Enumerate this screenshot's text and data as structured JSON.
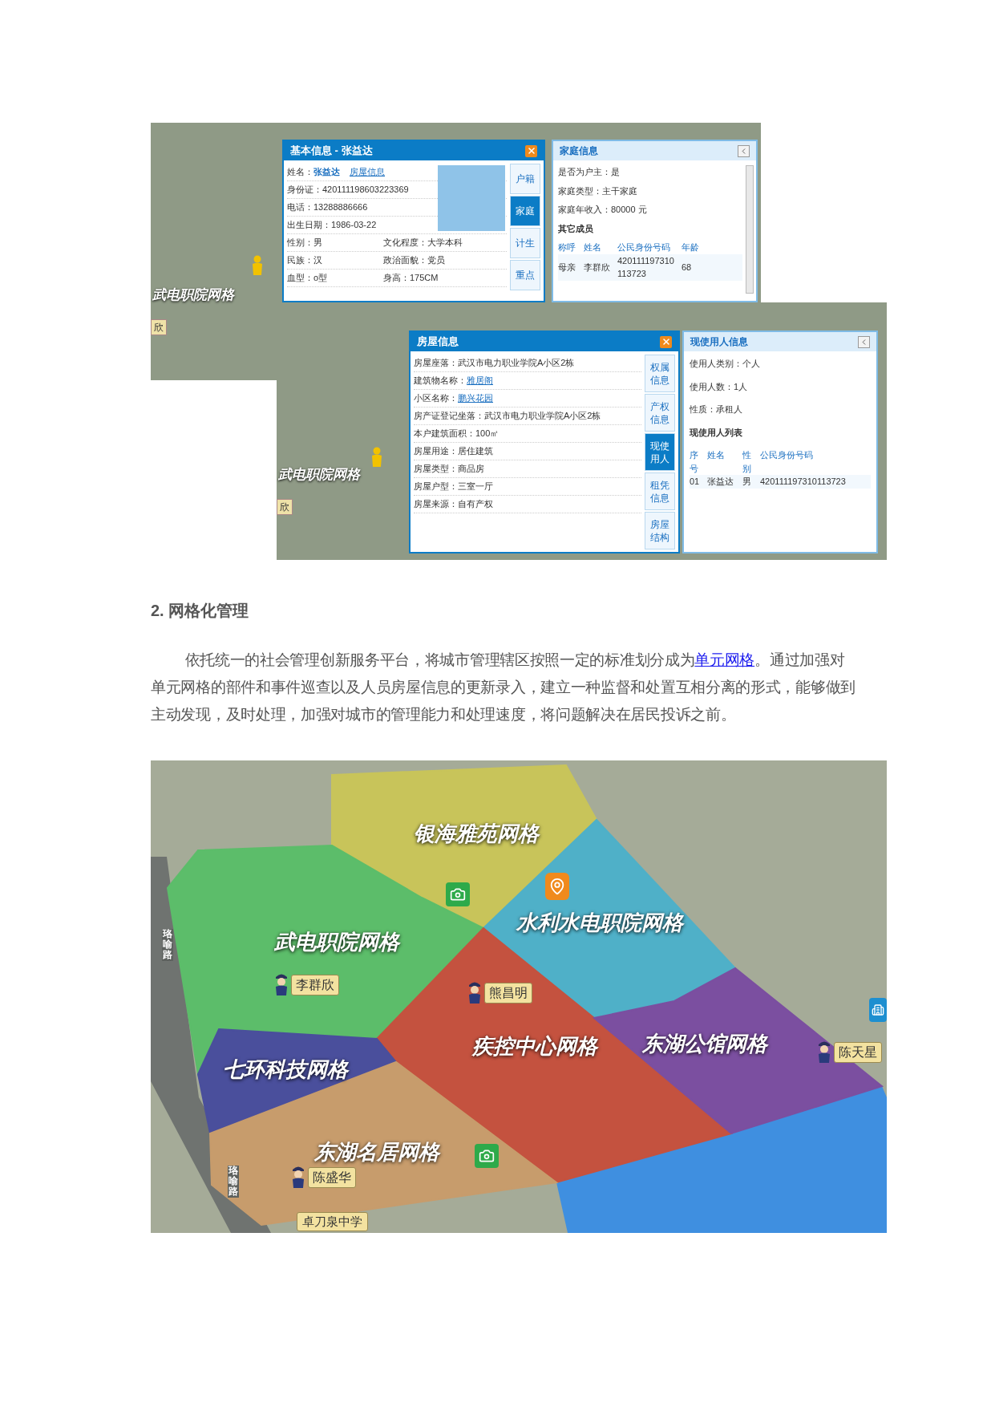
{
  "figure_1": {
    "screenshot_1": {
      "map_labels": [
        "武电职院网格"
      ],
      "map_badges": [
        "欣"
      ],
      "basic_info_panel": {
        "title": "基本信息 - 张益达",
        "rows": [
          [
            {
              "label": "姓名：",
              "value": "张益达",
              "kind": "highlight"
            },
            {
              "value": "房屋信息",
              "kind": "link"
            }
          ],
          [
            {
              "label": "身份证：",
              "value": "420111198603223369",
              "kind": "plain"
            }
          ],
          [
            {
              "label": "电话：",
              "value": "13288886666",
              "kind": "plain"
            }
          ],
          [
            {
              "label": "出生日期：",
              "value": "1986-03-22",
              "kind": "plain"
            }
          ],
          [
            {
              "label": "性别：",
              "value": "男",
              "kind": "plain"
            },
            {
              "label": "文化程度：",
              "value": "大学本科",
              "kind": "plain"
            }
          ],
          [
            {
              "label": "民族：",
              "value": "汉",
              "kind": "plain"
            },
            {
              "label": "政治面貌：",
              "value": "党员",
              "kind": "plain"
            }
          ],
          [
            {
              "label": "血型：",
              "value": "o型",
              "kind": "plain"
            },
            {
              "label": "身高：",
              "value": "175CM",
              "kind": "plain"
            }
          ]
        ],
        "tabs": [
          {
            "label": "户籍",
            "selected": false
          },
          {
            "label": "家庭",
            "selected": true
          },
          {
            "label": "计生",
            "selected": false
          },
          {
            "label": "重点",
            "selected": false
          }
        ]
      },
      "family_panel": {
        "title": "家庭信息",
        "fields": [
          {
            "label": "是否为户主：",
            "value": "是"
          },
          {
            "label": "家庭类型：",
            "value": "主干家庭"
          },
          {
            "label": "家庭年收入：",
            "value": "80000 元"
          }
        ],
        "subheading": "其它成员",
        "columns": [
          "称呼",
          "姓名",
          "公民身份号码",
          "年龄"
        ],
        "rows": [
          [
            "母亲",
            "李群欣",
            "420111197310113723",
            "68"
          ]
        ]
      }
    },
    "screenshot_2": {
      "map_labels": [
        "武电职院网格"
      ],
      "map_badges": [
        "欣"
      ],
      "house_panel": {
        "title": "房屋信息",
        "rows": [
          [
            {
              "label": "房屋座落：",
              "value": "武汉市电力职业学院A小区2栋",
              "kind": "plain"
            }
          ],
          [
            {
              "label": "建筑物名称：",
              "value": "雅居阁",
              "kind": "link"
            }
          ],
          [
            {
              "label": "小区名称：",
              "value": "鹏兴花园",
              "kind": "link"
            }
          ],
          [
            {
              "label": "房产证登记坐落：",
              "value": "武汉市电力职业学院A小区2栋",
              "kind": "plain"
            }
          ],
          [
            {
              "label": "本户建筑面积：",
              "value": "100㎡",
              "kind": "plain"
            }
          ],
          [
            {
              "label": "房屋用途：",
              "value": "居住建筑",
              "kind": "plain"
            }
          ],
          [
            {
              "label": "房屋类型：",
              "value": "商品房",
              "kind": "plain"
            }
          ],
          [
            {
              "label": "房屋户型：",
              "value": "三室一厅",
              "kind": "plain"
            }
          ],
          [
            {
              "label": "房屋来源：",
              "value": "自有产权",
              "kind": "plain"
            }
          ]
        ],
        "tabs": [
          {
            "label": "权属信息",
            "selected": false
          },
          {
            "label": "产权信息",
            "selected": false
          },
          {
            "label": "现使用人",
            "selected": true
          },
          {
            "label": "租凭信息",
            "selected": false
          },
          {
            "label": "房屋结构",
            "selected": false
          }
        ]
      },
      "occupant_panel": {
        "title": "现使用人信息",
        "fields": [
          {
            "label": "使用人类别：",
            "value": "个人"
          },
          {
            "label": "使用人数：",
            "value": "1人"
          },
          {
            "label": "性质：",
            "value": "承租人"
          }
        ],
        "subheading": "现使用人列表",
        "columns": [
          "序号",
          "姓名",
          "性别",
          "公民身份号码"
        ],
        "rows": [
          [
            "01",
            "张益达",
            "男",
            "420111197310113723"
          ]
        ]
      }
    }
  },
  "section": {
    "heading": "2. 网格化管理",
    "paragraph": {
      "before": "依托统一的社会管理创新服务平台，将城市管理辖区按照一定的标准划分成为",
      "link": "单元网格",
      "after": "。通过加强对单元网格的部件和事件巡查以及人员房屋信息的更新录入，建立一种监督和处置互相分离的形式，能够做到主动发现，及时处理，加强对城市的管理能力和处理速度，将问题解决在居民投诉之前。"
    }
  },
  "figure_2": {
    "grids": [
      {
        "name": "银海雅苑网格",
        "color": "#c8c45a"
      },
      {
        "name": "水利水电职院网格",
        "color": "#4fb0c8"
      },
      {
        "name": "武电职院网格",
        "color": "#5cbd6a"
      },
      {
        "name": "疾控中心网格",
        "color": "#c4523f"
      },
      {
        "name": "东湖公馆网格",
        "color": "#7b4fa0"
      },
      {
        "name": "七环科技网格",
        "color": "#4a4f9c"
      },
      {
        "name": "东湖名居网格",
        "color": "#c79c6c"
      }
    ],
    "officers": [
      "李群欣",
      "熊昌明",
      "陈天星",
      "陈盛华"
    ],
    "road_labels": [
      "珞喻路",
      "珞喻路"
    ],
    "school_label": "卓刀泉中学"
  }
}
